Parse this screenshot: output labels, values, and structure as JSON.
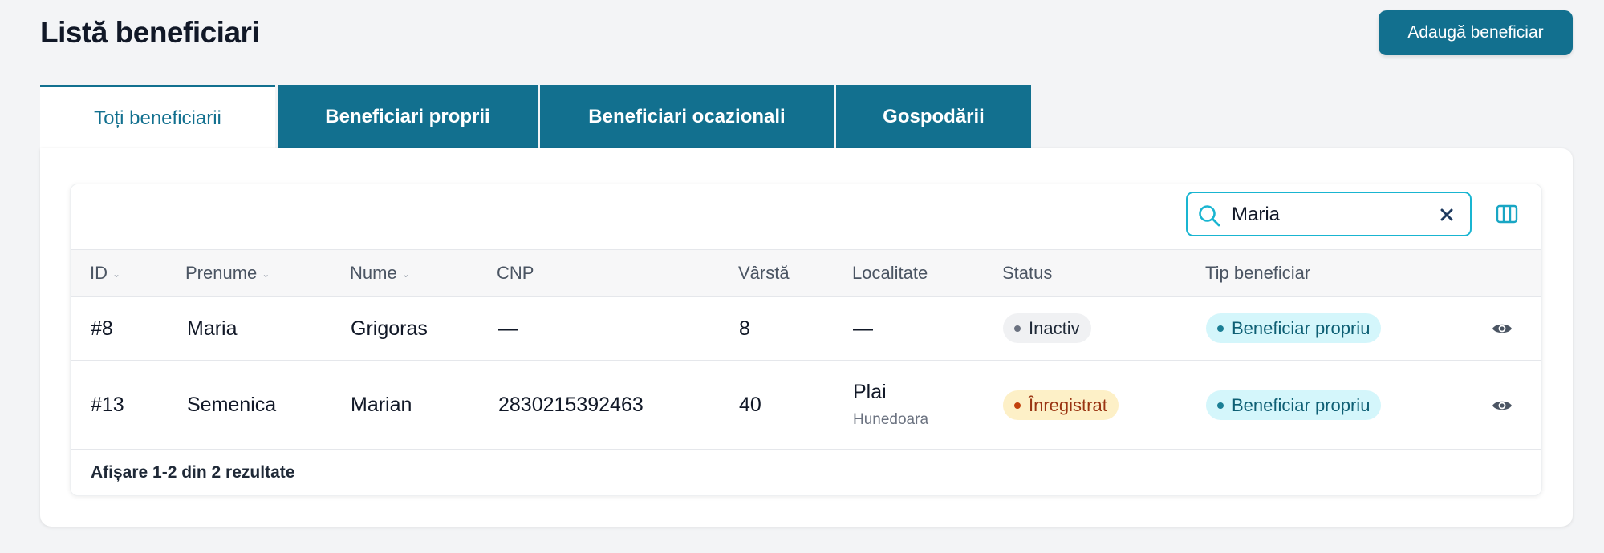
{
  "header": {
    "title": "Listă beneficiari",
    "add_button": "Adaugă beneficiar"
  },
  "tabs": [
    {
      "label": "Toți beneficiarii",
      "active": true
    },
    {
      "label": "Beneficiari proprii",
      "active": false
    },
    {
      "label": "Beneficiari ocazionali",
      "active": false
    },
    {
      "label": "Gospodării",
      "active": false
    }
  ],
  "search": {
    "value": "Maria",
    "icon": "search-icon",
    "clear_icon": "close-icon"
  },
  "columns_icon": "columns-icon",
  "table": {
    "headers": {
      "id": "ID",
      "prenume": "Prenume",
      "nume": "Nume",
      "cnp": "CNP",
      "varsta": "Vârstă",
      "localitate": "Localitate",
      "status": "Status",
      "tip": "Tip beneficiar"
    },
    "rows": [
      {
        "id": "#8",
        "prenume": "Maria",
        "nume": "Grigoras",
        "cnp": "—",
        "varsta": "8",
        "localitate": "—",
        "judet": "",
        "status": "Inactiv",
        "tip": "Beneficiar propriu"
      },
      {
        "id": "#13",
        "prenume": "Semenica",
        "nume": "Marian",
        "cnp": "2830215392463",
        "varsta": "40",
        "localitate": "Plai",
        "judet": "Hunedoara",
        "status": "Înregistrat",
        "tip": "Beneficiar propriu"
      }
    ]
  },
  "footer": {
    "results": "Afișare 1-2 din 2 rezultate"
  },
  "colors": {
    "primary": "#12708f",
    "search_border": "#19b5d1",
    "background": "#f3f4f6",
    "status_inactive_bg": "#f0f1f3",
    "status_registered_bg": "#fdf0c7",
    "type_badge_bg": "#d4f6fb"
  }
}
